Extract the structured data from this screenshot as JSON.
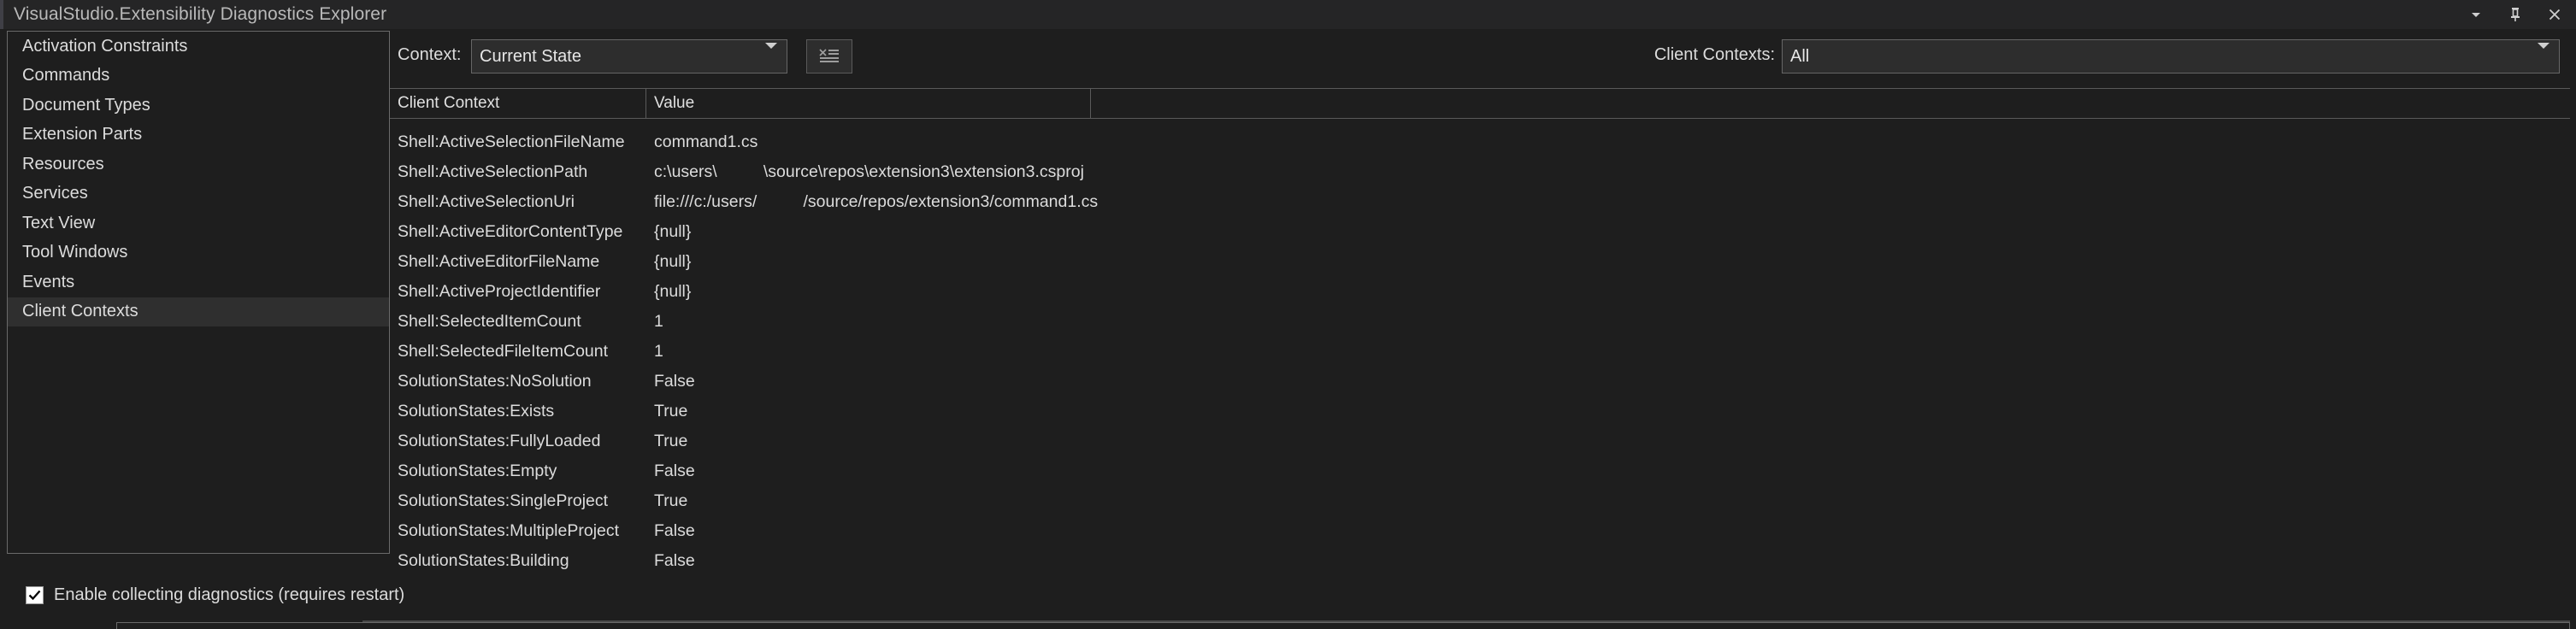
{
  "window": {
    "title": "VisualStudio.Extensibility Diagnostics Explorer",
    "controls": [
      {
        "name": "dropdown-chevron",
        "icon": "chevron-down-icon"
      },
      {
        "name": "pin",
        "icon": "pin-icon"
      },
      {
        "name": "close",
        "icon": "close-icon"
      }
    ]
  },
  "sidebar": {
    "items": [
      {
        "label": "Activation Constraints",
        "selected": false
      },
      {
        "label": "Commands",
        "selected": false
      },
      {
        "label": "Document Types",
        "selected": false
      },
      {
        "label": "Extension Parts",
        "selected": false
      },
      {
        "label": "Resources",
        "selected": false
      },
      {
        "label": "Services",
        "selected": false
      },
      {
        "label": "Text View",
        "selected": false
      },
      {
        "label": "Tool Windows",
        "selected": false
      },
      {
        "label": "Events",
        "selected": false
      },
      {
        "label": "Client Contexts",
        "selected": true
      }
    ]
  },
  "toolbar": {
    "context_label": "Context:",
    "context_value": "Current State",
    "clear_icon": "clear-list-icon",
    "client_contexts_label": "Client Contexts:",
    "client_contexts_value": "All"
  },
  "grid": {
    "columns": [
      "Client Context",
      "Value",
      ""
    ],
    "rows": [
      {
        "key": "Shell:ActiveSelectionFileName",
        "value": "command1.cs"
      },
      {
        "key": "Shell:ActiveSelectionPath",
        "value": "c:\\users\\          \\source\\repos\\extension3\\extension3.csproj"
      },
      {
        "key": "Shell:ActiveSelectionUri",
        "value": "file:///c:/users/          /source/repos/extension3/command1.cs"
      },
      {
        "key": "Shell:ActiveEditorContentType",
        "value": "{null}"
      },
      {
        "key": "Shell:ActiveEditorFileName",
        "value": "{null}"
      },
      {
        "key": "Shell:ActiveProjectIdentifier",
        "value": "{null}"
      },
      {
        "key": "Shell:SelectedItemCount",
        "value": "1"
      },
      {
        "key": "Shell:SelectedFileItemCount",
        "value": "1"
      },
      {
        "key": "SolutionStates:NoSolution",
        "value": "False"
      },
      {
        "key": "SolutionStates:Exists",
        "value": "True"
      },
      {
        "key": "SolutionStates:FullyLoaded",
        "value": "True"
      },
      {
        "key": "SolutionStates:Empty",
        "value": "False"
      },
      {
        "key": "SolutionStates:SingleProject",
        "value": "True"
      },
      {
        "key": "SolutionStates:MultipleProject",
        "value": "False"
      },
      {
        "key": "SolutionStates:Building",
        "value": "False"
      }
    ]
  },
  "footer": {
    "checkbox_label": "Enable collecting diagnostics (requires restart)",
    "checkbox_checked": true,
    "check_glyph": "✔"
  },
  "colors": {
    "background": "#1e1e1e",
    "titlebar": "#252526",
    "panel_border": "#6a6a6a",
    "selection": "#2f2f2f",
    "text": "#dcdcdc",
    "control_fill": "#2d2d2d"
  }
}
